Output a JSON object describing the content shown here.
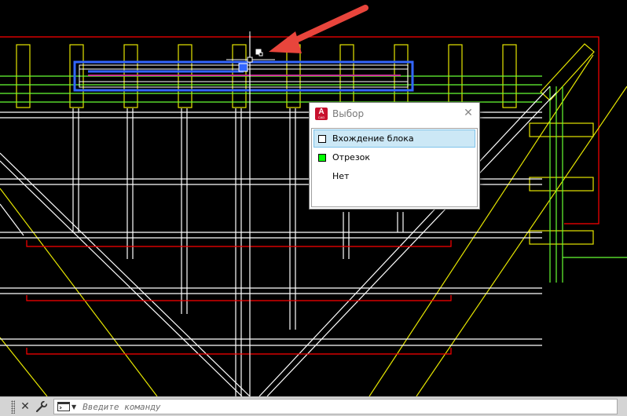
{
  "selection_dialog": {
    "title": "Выбор",
    "app_icon_letter": "A",
    "app_icon_sub": "CAD",
    "items": [
      {
        "label": "Вхождение блока",
        "swatch_color": "#ffffff",
        "selected": true
      },
      {
        "label": "Отрезок",
        "swatch_color": "#00ff00",
        "selected": false
      },
      {
        "label": "Нет",
        "swatch_color": "",
        "selected": false
      }
    ]
  },
  "command_line": {
    "placeholder": "Введите команду"
  },
  "colors": {
    "background": "#000000",
    "white_lines": "#ffffff",
    "yellow_lines": "#e6e600",
    "red_lines": "#ff0000",
    "green_lines": "#66ff33",
    "selection_blue": "#3366ff",
    "annotation_arrow": "#e8453c"
  },
  "icons": [
    "app-icon",
    "close-icon",
    "wrench-icon",
    "command-prompt-icon",
    "arrow-annotation-icon"
  ]
}
